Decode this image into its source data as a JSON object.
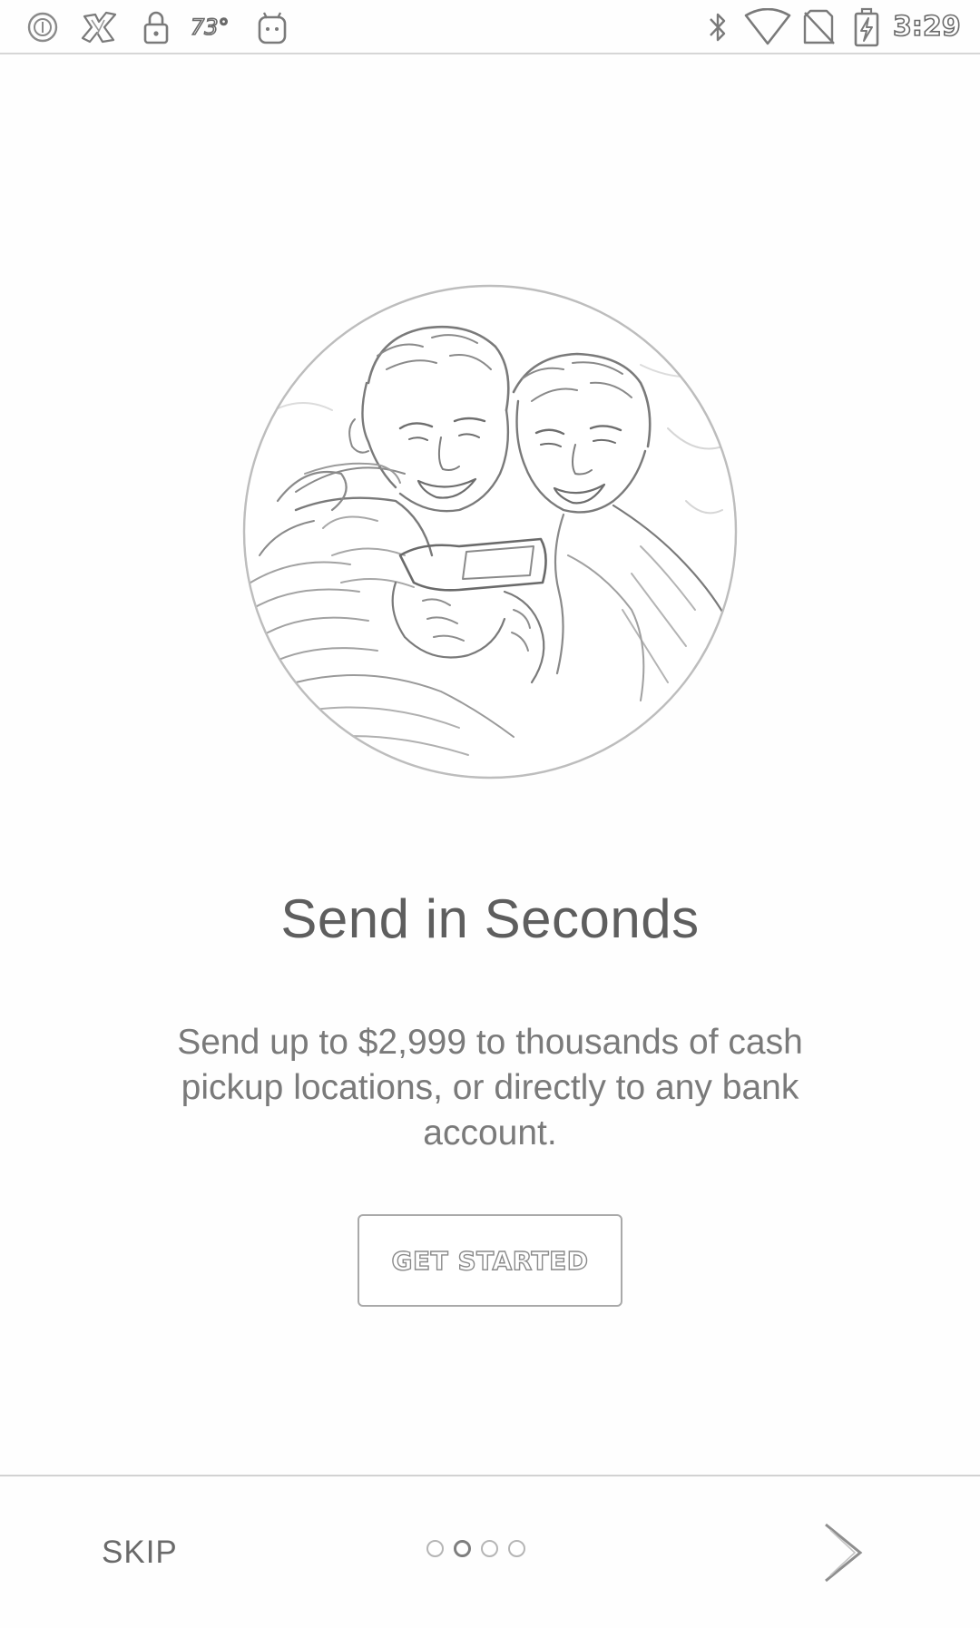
{
  "status_bar": {
    "temperature": "73°",
    "time": "3:29",
    "left_icons": [
      "circle-o-icon",
      "brand-logo-icon",
      "lock-icon",
      "android-icon"
    ],
    "right_icons": [
      "bluetooth-icon",
      "wifi-icon",
      "no-sim-icon",
      "battery-charging-icon"
    ]
  },
  "onboarding": {
    "hero_image": "couple-looking-at-phone-photo",
    "title": "Send in Seconds",
    "description": "Send up to $2,999 to thousands of cash pickup locations, or directly to any bank account.",
    "cta_label": "GET STARTED"
  },
  "bottom_nav": {
    "skip_label": "SKIP",
    "page_count": 4,
    "current_page": 2,
    "next_icon": "chevron-right-icon"
  }
}
